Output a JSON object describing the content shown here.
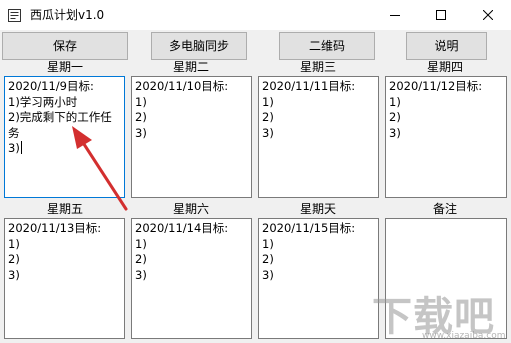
{
  "window": {
    "title": "西瓜计划v1.0"
  },
  "toolbar": {
    "save": "保存",
    "multi_sync": "多电脑同步",
    "qrcode": "二维码",
    "help": "说明"
  },
  "days": [
    {
      "label": "星期一",
      "text": "2020/11/9目标:\n1)学习两小时\n2)完成剩下的工作任务\n3)"
    },
    {
      "label": "星期二",
      "text": "2020/11/10目标:\n1)\n2)\n3)"
    },
    {
      "label": "星期三",
      "text": "2020/11/11目标:\n1)\n2)\n3)"
    },
    {
      "label": "星期四",
      "text": "2020/11/12目标:\n1)\n2)\n3)"
    },
    {
      "label": "星期五",
      "text": "2020/11/13目标:\n1)\n2)\n3)"
    },
    {
      "label": "星期六",
      "text": "2020/11/14目标:\n1)\n2)\n3)"
    },
    {
      "label": "星期天",
      "text": "2020/11/15目标:\n1)\n2)\n3)"
    },
    {
      "label": "备注",
      "text": ""
    }
  ],
  "annotation": {
    "color": "#d32f2f",
    "icon": "red-arrow"
  },
  "watermark": {
    "logo_text": "下载吧",
    "url_text": "www.xiazaiba.com"
  },
  "colors": {
    "focus_border": "#0078d7",
    "button_bg": "#e1e1e1"
  }
}
